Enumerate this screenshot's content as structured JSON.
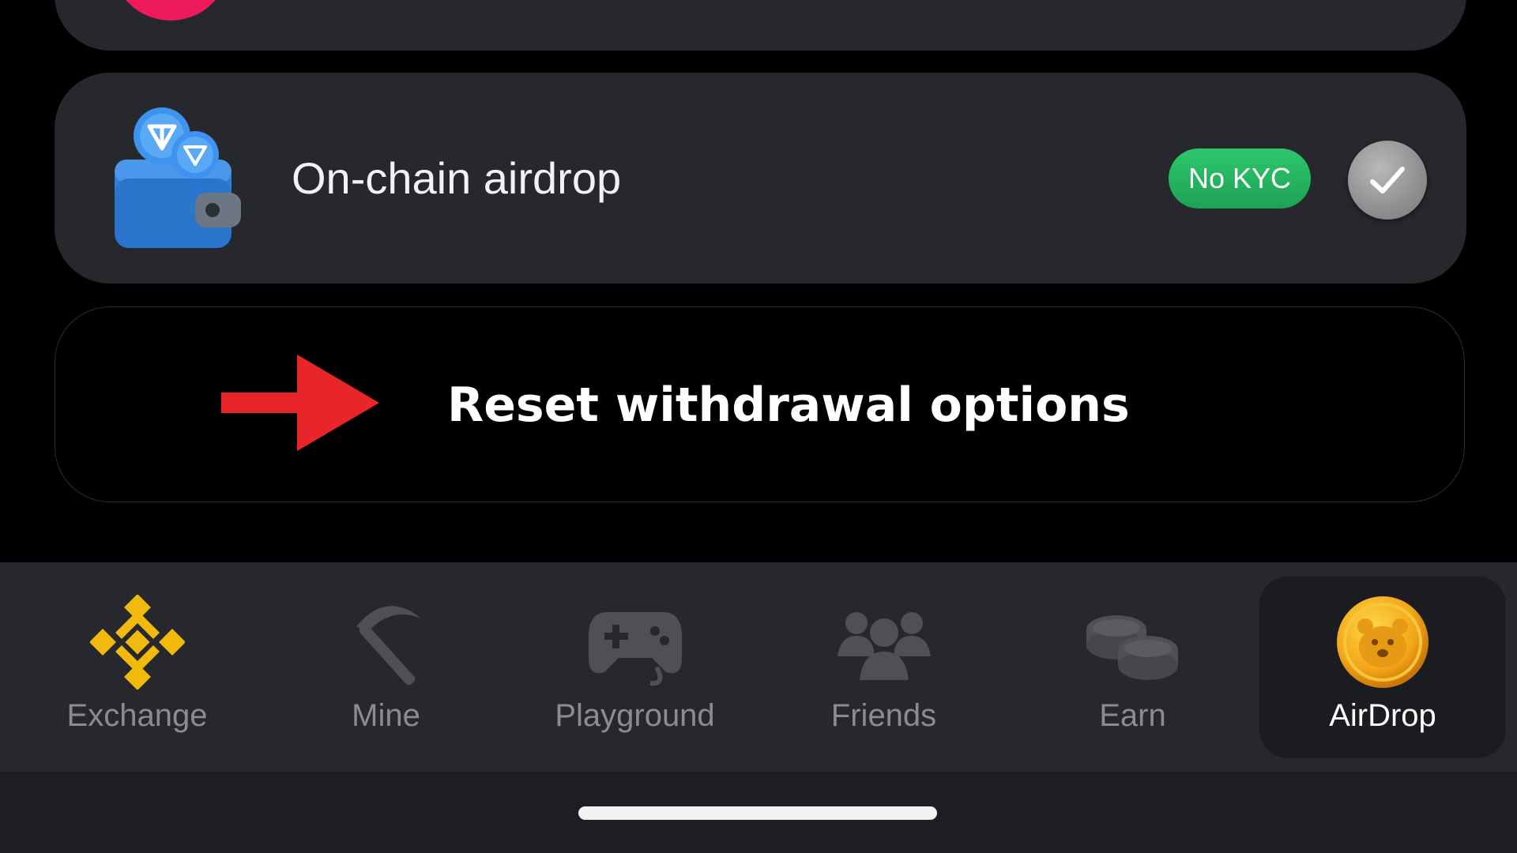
{
  "app": {
    "accent_color": "#f0b90b",
    "active_color": "#ffffff",
    "inactive_color": "#8a8c91"
  },
  "options": {
    "onchain": {
      "label": "On-chain airdrop",
      "badge": "No KYC",
      "badge_color": "#22b35e",
      "icon": "ton-wallet-icon",
      "selected": true
    },
    "reset": {
      "label": "Reset withdrawal options",
      "arrow_color": "#e8262a"
    }
  },
  "nav": {
    "items": [
      {
        "label": "Exchange",
        "icon": "exchange-diamond-icon",
        "active": false
      },
      {
        "label": "Mine",
        "icon": "pickaxe-icon",
        "active": false
      },
      {
        "label": "Playground",
        "icon": "gamepad-icon",
        "active": false
      },
      {
        "label": "Friends",
        "icon": "friends-icon",
        "active": false
      },
      {
        "label": "Earn",
        "icon": "coins-icon",
        "active": false
      },
      {
        "label": "AirDrop",
        "icon": "hamster-coin-icon",
        "active": true
      }
    ]
  }
}
